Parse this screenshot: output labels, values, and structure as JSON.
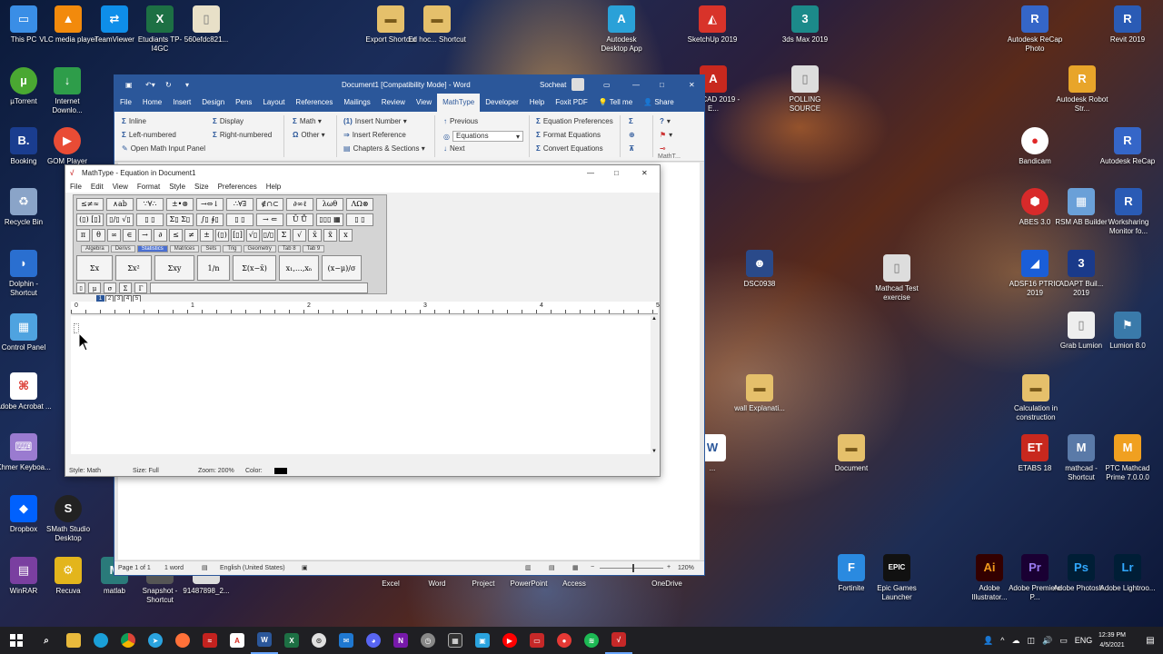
{
  "desktop_left": [
    {
      "label": "This PC",
      "icon": "computer-icon",
      "color": "#3a8ee6"
    },
    {
      "label": "VLC media player",
      "icon": "vlc-icon",
      "color": "#f28a0c"
    },
    {
      "label": "TeamViewer",
      "icon": "teamviewer-icon",
      "color": "#0e8ee9"
    },
    {
      "label": "Etudiants TP-I4GC",
      "icon": "excel-file-icon",
      "color": "#1d7044"
    },
    {
      "label": "560efdc821...",
      "icon": "image-file-icon",
      "color": "#e8e0c8"
    },
    {
      "label": "µTorrent",
      "icon": "utorrent-icon",
      "color": "#4aa832"
    },
    {
      "label": "Internet Downlo...",
      "icon": "idm-icon",
      "color": "#2e9d4a"
    },
    {
      "label": "Booking",
      "icon": "booking-icon",
      "color": "#1a3d8f"
    },
    {
      "label": "GOM Player",
      "icon": "gom-icon",
      "color": "#e94c35"
    },
    {
      "label": "Recycle Bin",
      "icon": "recycle-bin-icon",
      "color": "#8aa4c8"
    },
    {
      "label": "Dolphin - Shortcut",
      "icon": "dolphin-icon",
      "color": "#2a6fd0"
    },
    {
      "label": "Control Panel",
      "icon": "control-panel-icon",
      "color": "#4fa3e0"
    },
    {
      "label": "Adobe Acrobat ...",
      "icon": "acrobat-icon",
      "color": "#d8271e"
    },
    {
      "label": "Khmer Keyboa...",
      "icon": "keyboard-icon",
      "color": "#9a7bd0"
    },
    {
      "label": "Dropbox",
      "icon": "dropbox-icon",
      "color": "#0061fe"
    },
    {
      "label": "SMath Studio Desktop",
      "icon": "smath-icon",
      "color": "#222222"
    },
    {
      "label": "WinRAR",
      "icon": "winrar-icon",
      "color": "#7a3fa0"
    },
    {
      "label": "Recuva",
      "icon": "recuva-icon",
      "color": "#e3b51c"
    },
    {
      "label": "matlab",
      "icon": "matlab-icon",
      "color": "#2a7a7a"
    },
    {
      "label": "Snapshot - Shortcut",
      "icon": "snapshot-icon",
      "color": "#555555"
    },
    {
      "label": "91487898_2...",
      "icon": "file-icon",
      "color": "#dddddd"
    }
  ],
  "desktop_top": [
    {
      "label": "Export Shortcut",
      "icon": "folder-icon",
      "color": "#e5c06b"
    },
    {
      "label": "Ed hoc... Shortcut",
      "icon": "folder-icon",
      "color": "#e5c06b"
    },
    {
      "label": "Autodesk Desktop App",
      "icon": "autodesk-icon",
      "color": "#2aa1d8"
    },
    {
      "label": "SketchUp 2019",
      "icon": "sketchup-icon",
      "color": "#d8332a"
    },
    {
      "label": "3ds Max 2019",
      "icon": "3dsmax-icon",
      "color": "#1c8a8a"
    },
    {
      "label": "Autodesk ReCap Photo",
      "icon": "recap-photo-icon",
      "color": "#3566c8"
    },
    {
      "label": "Revit 2019",
      "icon": "revit-icon",
      "color": "#2a5bb5"
    }
  ],
  "desktop_right": [
    {
      "label": "AutoCAD 2019 - E...",
      "icon": "autocad-icon",
      "color": "#c8281e"
    },
    {
      "label": "POLLING SOURCE",
      "icon": "file-icon",
      "color": "#dddddd"
    },
    {
      "label": "Autodesk Robot Str...",
      "icon": "robot-icon",
      "color": "#e8a52a"
    },
    {
      "label": "Bandicam",
      "icon": "bandicam-icon",
      "color": "#e02828"
    },
    {
      "label": "Autodesk ReCap",
      "icon": "recap-icon",
      "color": "#3566c8"
    },
    {
      "label": "ABES 3.0",
      "icon": "abes-icon",
      "color": "#d82a2a"
    },
    {
      "label": "RSM AB Builder",
      "icon": "rsm-icon",
      "color": "#6aa0d8"
    },
    {
      "label": "Worksharing Monitor fo...",
      "icon": "worksharing-icon",
      "color": "#2a5bb5"
    },
    {
      "label": "ADSF16 PTRIC 2019",
      "icon": "adsf-icon",
      "color": "#1a5ed8"
    },
    {
      "label": "ADAPT Buil... 2019",
      "icon": "adapt-icon",
      "color": "#1a3a8a"
    },
    {
      "label": "Mathcad Test exercise",
      "icon": "folder-icon",
      "color": "#dddddd"
    },
    {
      "label": "Grab Lumion",
      "icon": "file-icon",
      "color": "#eeeeee"
    },
    {
      "label": "Lumion 8.0",
      "icon": "lumion-icon",
      "color": "#3a7aaa"
    },
    {
      "label": "DSC0938",
      "icon": "photo-icon",
      "color": "#2a4a8a"
    },
    {
      "label": "wall Explanati...",
      "icon": "folder-icon",
      "color": "#e5c06b"
    },
    {
      "label": "Calculation in construction",
      "icon": "folder-icon",
      "color": "#e5c06b"
    },
    {
      "label": "ETABS 18",
      "icon": "etabs-icon",
      "color": "#c8281e"
    },
    {
      "label": "mathcad - Shortcut",
      "icon": "mathcad-icon",
      "color": "#5a7aa8"
    },
    {
      "label": "PTC Mathcad Prime 7.0.0.0",
      "icon": "mathcad-prime-icon",
      "color": "#f0a020"
    },
    {
      "label": "Document",
      "icon": "folder-icon",
      "color": "#e5c06b"
    },
    {
      "label": "Fortinite",
      "icon": "fortnite-icon",
      "color": "#2a8ae0"
    },
    {
      "label": "Epic Games Launcher",
      "icon": "epic-icon",
      "color": "#111111"
    },
    {
      "label": "Adobe Illustrator...",
      "icon": "illustrator-icon",
      "color": "#f29a1c"
    },
    {
      "label": "Adobe Premiere P...",
      "icon": "premiere-icon",
      "color": "#9a7bf0"
    },
    {
      "label": "Adobe Photosh...",
      "icon": "photoshop-icon",
      "color": "#31a8ff"
    },
    {
      "label": "Adobe Lightroo...",
      "icon": "lightroom-icon",
      "color": "#31a8ff"
    }
  ],
  "desktop_behind": [
    {
      "label": "Excel",
      "icon": "excel-icon"
    },
    {
      "label": "Word",
      "icon": "word-icon"
    },
    {
      "label": "Project",
      "icon": "project-icon"
    },
    {
      "label": "PowerPoint",
      "icon": "powerpoint-icon"
    },
    {
      "label": "Access",
      "icon": "access-icon"
    },
    {
      "label": "OneDrive",
      "icon": "onedrive-icon"
    }
  ],
  "word": {
    "title": "Document1 [Compatibility Mode] - Word",
    "user": "Socheat",
    "tabs": [
      "File",
      "Home",
      "Insert",
      "Design",
      "Pens",
      "Layout",
      "References",
      "Mailings",
      "Review",
      "View",
      "MathType",
      "Developer",
      "Help",
      "Foxit PDF",
      "Tell me",
      "Share"
    ],
    "active_tab": "MathType",
    "ribbon": {
      "inline": "Inline",
      "display": "Display",
      "left_numbered": "Left-numbered",
      "right_numbered": "Right-numbered",
      "open_math_input": "Open Math Input Panel",
      "math": "Math",
      "other": "Other",
      "insert_number": "Insert Number",
      "insert_reference": "Insert Reference",
      "chapters_sections": "Chapters & Sections",
      "previous": "Previous",
      "equations_value": "Equations",
      "next": "Next",
      "equation_preferences": "Equation Preferences",
      "format_equations": "Format Equations",
      "convert_equations": "Convert Equations",
      "mathtype_group": "MathT..."
    },
    "status": {
      "page": "Page 1 of 1",
      "words": "1 word",
      "language": "English (United States)",
      "zoom": "120%"
    }
  },
  "mathtype": {
    "title": "MathType - Equation in Document1",
    "menu": [
      "File",
      "Edit",
      "View",
      "Format",
      "Style",
      "Size",
      "Preferences",
      "Help"
    ],
    "row1": [
      "≤≠≈",
      "∧ab",
      "∵∀∴",
      "±•⊗",
      "→⇔↓",
      "∴∀∃",
      "∉∩⊂",
      "∂∞ℓ",
      "λωθ",
      "ΛΩ⊗"
    ],
    "row2": [
      "(▯) [▯]",
      "▯/▯ √▯",
      "▯ ▯",
      "Σ▯ Σ▯",
      "∫▯ ∮▯",
      "▯ ▯",
      "→ ⇐",
      "Ū Ů",
      "▯▯▯ ▦",
      "▯ ▯"
    ],
    "row3": [
      "π",
      "θ",
      "∞",
      "∈",
      "→",
      "∂",
      "≤",
      "≠",
      "±",
      "(▯)",
      "[▯]",
      "√▯",
      "▯/▯",
      "Σ",
      "√",
      "x̄",
      "x̃",
      "x"
    ],
    "tabs": [
      "Algebra",
      "Derivs",
      "Statistics",
      "Matrices",
      "Sets",
      "Trig",
      "Geometry",
      "Tab 8",
      "Tab 9"
    ],
    "active_tab": "Statistics",
    "big": [
      "Σx",
      "Σx²",
      "Σxy",
      "1/n",
      "Σ(x−x̄)",
      "x₁,…,xₙ",
      "(x−μ)/σ"
    ],
    "small": [
      "μ",
      "σ",
      "Σ",
      "Γ"
    ],
    "ruler": [
      "0",
      "1",
      "2",
      "3",
      "4",
      "5"
    ],
    "status": {
      "style": "Style: Math",
      "size": "Size: Full",
      "zoom": "Zoom: 200%",
      "color": "Color:"
    }
  },
  "taskbar": {
    "apps": [
      "start-icon",
      "search-icon",
      "file-explorer-icon",
      "edge-icon",
      "chrome-icon",
      "telegram-icon",
      "firefox-icon",
      "fontstudio-icon",
      "acrobat-icon",
      "word-icon",
      "excel-icon",
      "steam-icon",
      "mail-icon",
      "discord-icon",
      "onenote-icon",
      "clock-icon",
      "calendar-icon",
      "photos-icon",
      "youtube-icon",
      "presentation-icon",
      "record-icon",
      "spotify-icon",
      "mathtype-icon"
    ],
    "language": "ENG",
    "time": "12:39 PM",
    "date": "4/5/2021"
  }
}
